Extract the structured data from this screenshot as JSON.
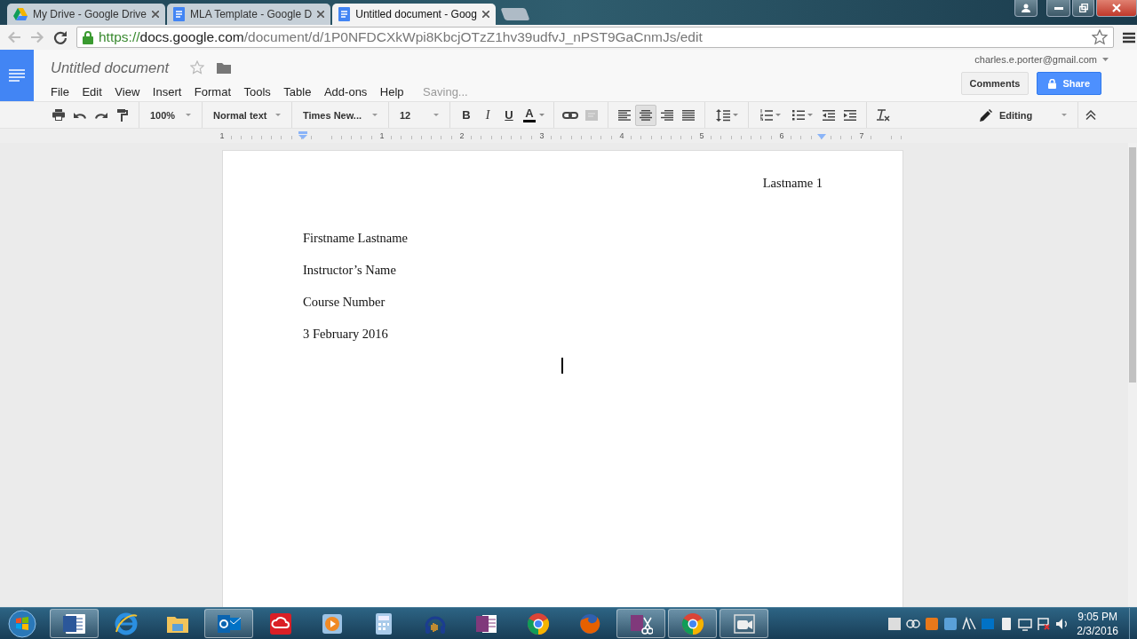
{
  "browser_tabs": [
    {
      "kind": "drive",
      "title": "My Drive - Google Drive",
      "selected": false
    },
    {
      "kind": "docs",
      "title": "MLA Template - Google D",
      "selected": false
    },
    {
      "kind": "docs",
      "title": "Untitled document - Goog",
      "selected": true
    }
  ],
  "address_bar": {
    "scheme": "https://",
    "host": "docs.google.com",
    "path": "/document/d/1P0NFDCXkWpi8KbcjOTzZ1hv39udfvJ_nPST9GaCnmJs/edit"
  },
  "docs_header": {
    "title": "Untitled document",
    "menu": [
      "File",
      "Edit",
      "View",
      "Insert",
      "Format",
      "Tools",
      "Table",
      "Add-ons",
      "Help"
    ],
    "save_status": "Saving...",
    "account": "charles.e.porter@gmail.com",
    "buttons": [
      {
        "kind": "comments",
        "label": "Comments"
      },
      {
        "kind": "share",
        "label": "Share"
      }
    ]
  },
  "toolbar": {
    "zoom": "100%",
    "style": "Normal text",
    "font": "Times New...",
    "size": "12",
    "format_buttons": [
      {
        "kind": "bold",
        "label": "B"
      },
      {
        "kind": "italic",
        "label": "I"
      },
      {
        "kind": "underline",
        "label": "U"
      },
      {
        "kind": "color",
        "label": "A"
      }
    ],
    "alignment": [
      {
        "selected": false
      },
      {
        "selected": true
      },
      {
        "selected": false
      },
      {
        "selected": false
      }
    ],
    "mode": "Editing"
  },
  "ruler": {
    "labels": [
      "1",
      "1",
      "2",
      "3",
      "4",
      "5",
      "6",
      "7"
    ]
  },
  "document": {
    "header": "Lastname 1",
    "paragraphs": [
      "Firstname Lastname",
      "Instructor’s Name",
      "Course Number",
      "3 February 2016"
    ]
  },
  "taskbar": {
    "apps": [
      {
        "kind": "word",
        "active": true
      },
      {
        "kind": "ie",
        "active": false
      },
      {
        "kind": "explorer",
        "active": false
      },
      {
        "kind": "outlook",
        "active": true
      },
      {
        "kind": "creativecloud",
        "active": false
      },
      {
        "kind": "media",
        "active": false
      },
      {
        "kind": "calculator",
        "active": false
      },
      {
        "kind": "audacity",
        "active": false
      },
      {
        "kind": "onenote",
        "active": false
      },
      {
        "kind": "chrome",
        "active": false
      },
      {
        "kind": "firefox",
        "active": false
      },
      {
        "kind": "clipper",
        "active": true
      },
      {
        "kind": "chrome",
        "active": true
      },
      {
        "kind": "video",
        "active": true
      }
    ],
    "clock": {
      "time": "9:05 PM",
      "date": "2/3/2016"
    }
  }
}
